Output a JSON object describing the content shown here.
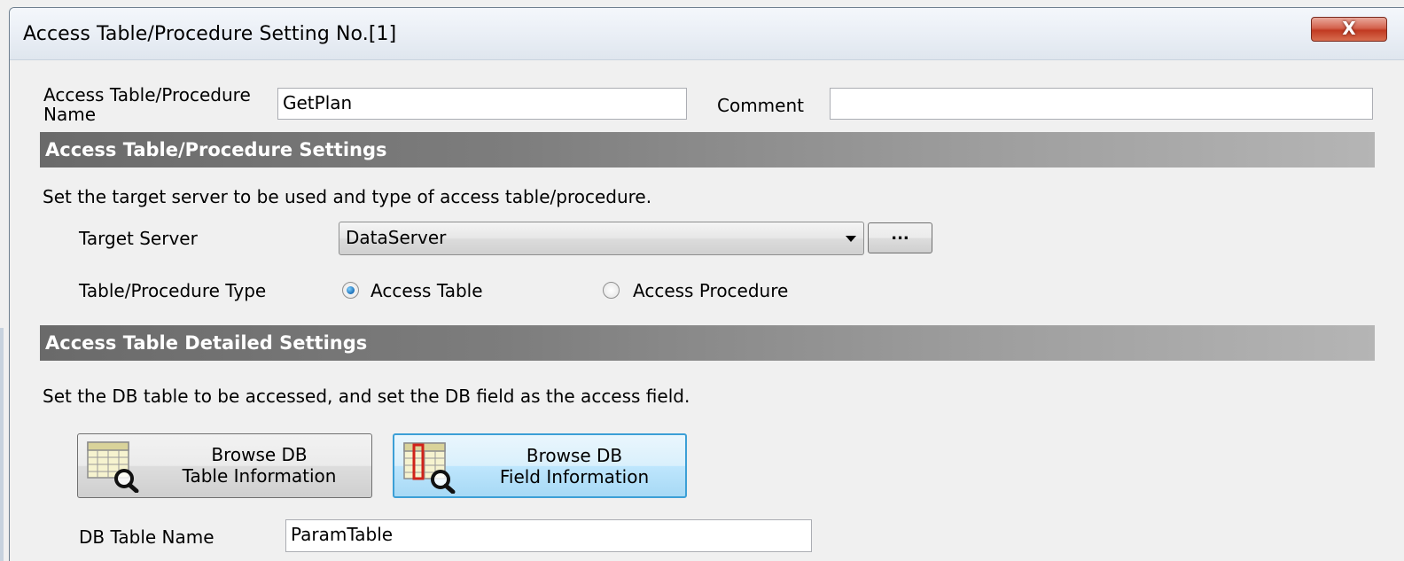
{
  "window": {
    "title": "Access Table/Procedure Setting No.[1]",
    "close_label": "X"
  },
  "header": {
    "name_label_line1": "Access Table/Procedure",
    "name_label_line2": "Name",
    "name_value": "GetPlan",
    "comment_label": "Comment",
    "comment_value": ""
  },
  "settings_section": {
    "title": "Access Table/Procedure Settings",
    "description": "Set the target server to be used and type of access table/procedure.",
    "target_server_label": "Target Server",
    "target_server_value": "DataServer",
    "browse_label": "...",
    "type_label": "Table/Procedure Type",
    "type_options": [
      {
        "label": "Access Table",
        "selected": true
      },
      {
        "label": "Access Procedure",
        "selected": false
      }
    ]
  },
  "detail_section": {
    "title": "Access Table Detailed Settings",
    "description": "Set the DB table to be accessed, and set the DB field as the access field.",
    "browse_table_line1": "Browse DB",
    "browse_table_line2": "Table Information",
    "browse_field_line1": "Browse DB",
    "browse_field_line2": "Field Information",
    "table_name_label": "DB Table Name",
    "table_name_value": "ParamTable"
  },
  "colors": {
    "section_header_dark": "#6a6a6a",
    "section_header_light": "#b5b5b5",
    "selected_button_border": "#3c9fd6",
    "close_button": "#c13a22"
  },
  "icons": [
    "table-search-icon",
    "field-search-icon",
    "dropdown-arrow-icon",
    "radio-button-icon"
  ]
}
